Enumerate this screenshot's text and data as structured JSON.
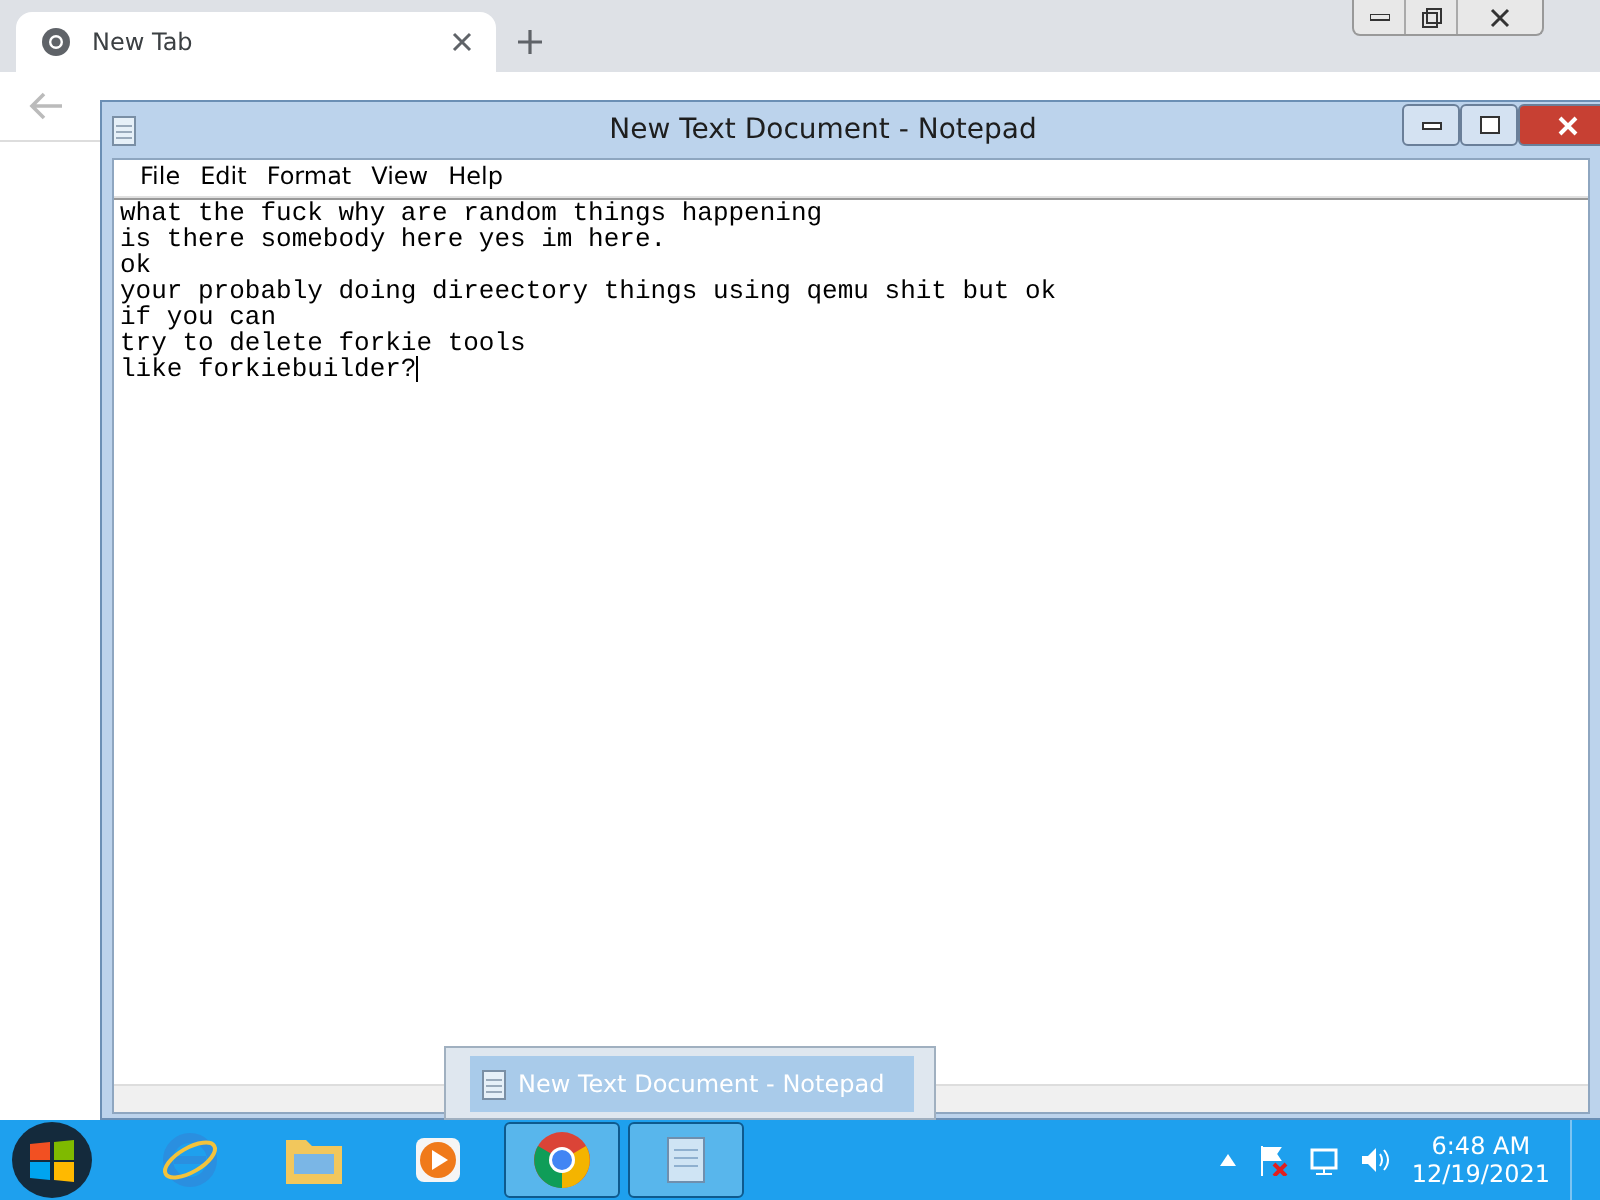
{
  "browser": {
    "tab": {
      "title": "New Tab"
    }
  },
  "notepad": {
    "title": "New Text Document - Notepad",
    "menu": [
      "File",
      "Edit",
      "Format",
      "View",
      "Help"
    ],
    "lines": [
      "what the fuck why are random things happening",
      "is there somebody here yes im here.",
      "ok",
      "your probably doing direectory things using qemu shit but ok",
      "if you can",
      "try to delete forkie tools",
      "like forkiebuilder?"
    ]
  },
  "thumbnail": {
    "title": "New Text Document - Notepad"
  },
  "taskbar": {
    "items": [
      {
        "kind": "ie",
        "open": false
      },
      {
        "kind": "explorer",
        "open": false
      },
      {
        "kind": "media",
        "open": false
      },
      {
        "kind": "chrome",
        "open": true
      },
      {
        "kind": "notepad",
        "open": true
      }
    ],
    "time": "6:48 AM",
    "date": "12/19/2021"
  }
}
